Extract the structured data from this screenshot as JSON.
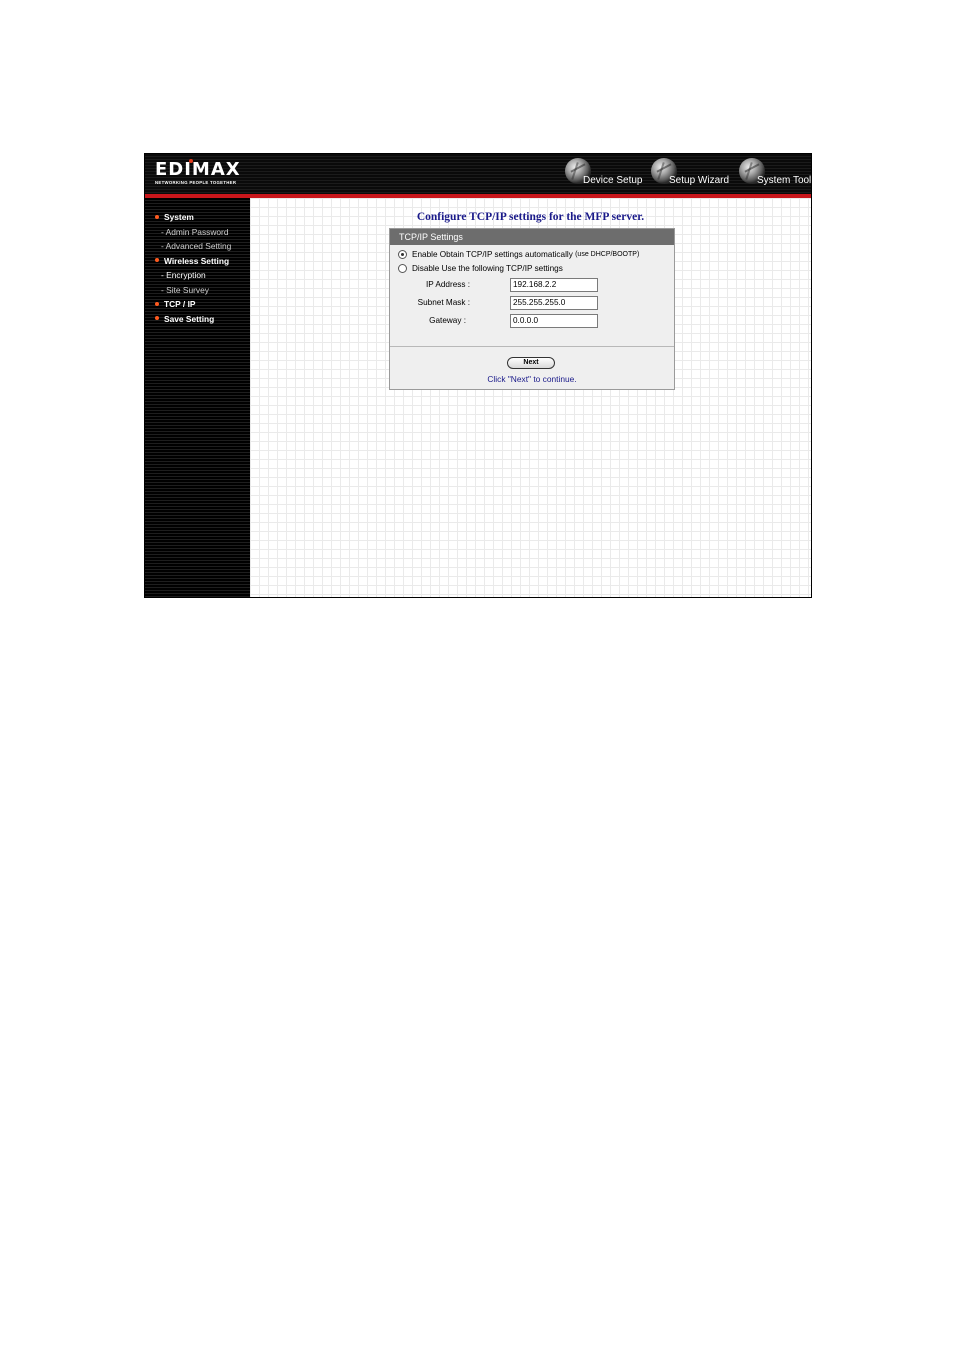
{
  "brand": {
    "logo": "EDIMAX",
    "tagline": "NETWORKING PEOPLE TOGETHER",
    "accent": "#c8161b"
  },
  "nav": [
    {
      "label": "Device Setup",
      "icon": "globe-icon"
    },
    {
      "label": "Setup Wizard",
      "icon": "globe-icon"
    },
    {
      "label": "System Tools",
      "icon": "globe-icon"
    }
  ],
  "sidebar": {
    "items": [
      {
        "label": "System"
      },
      {
        "label": "- Admin Password"
      },
      {
        "label": "- Advanced Setting"
      },
      {
        "label": "Wireless Setting"
      },
      {
        "label": "- Encryption"
      },
      {
        "label": "- Site Survey"
      },
      {
        "label": "TCP / IP"
      },
      {
        "label": "Save Setting"
      }
    ]
  },
  "main": {
    "title": "Configure TCP/IP settings for the MFP server.",
    "panel_title": "TCP/IP Settings",
    "option_auto": {
      "label": "Enable Obtain TCP/IP settings automatically",
      "note": "(use DHCP/BOOTP)",
      "checked": true
    },
    "option_manual": {
      "label": "Disable Use the following TCP/IP settings",
      "checked": false
    },
    "fields": [
      {
        "label": "IP Address :",
        "value": "192.168.2.2"
      },
      {
        "label": "Subnet Mask :",
        "value": "255.255.255.0"
      },
      {
        "label": "Gateway :",
        "value": "0.0.0.0"
      }
    ],
    "next_label": "Next",
    "hint": "Click \"Next\" to continue."
  }
}
